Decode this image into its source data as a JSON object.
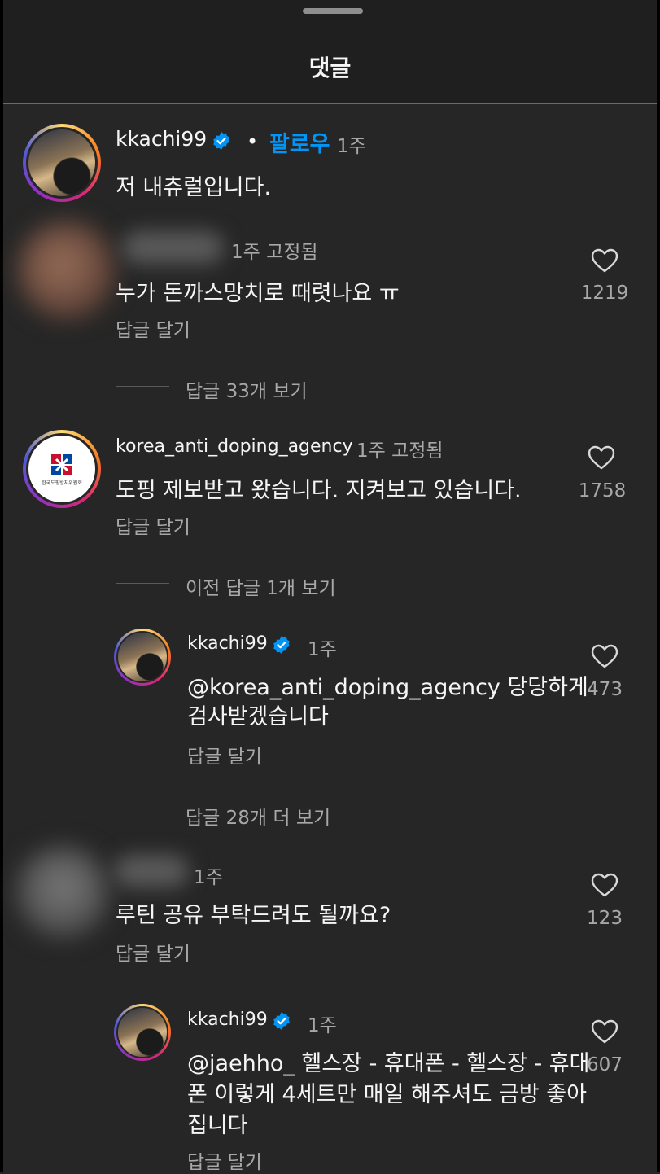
{
  "header": {
    "title": "댓글"
  },
  "comments": [
    {
      "username": "kkachi99",
      "follow_label": "팔로우",
      "time": "1주",
      "text": "저 내츄럴입니다."
    },
    {
      "meta": "1주 고정됨",
      "text": "누가 돈까스망치로 때렷나요 ㅠ",
      "reply_label": "답글 달기",
      "likes": "1219",
      "view_replies": "답글 33개 보기"
    },
    {
      "username": "korea_anti_doping_agency",
      "meta": "1주 고정됨",
      "text": "도핑 제보받고 왔습니다. 지켜보고 있습니다.",
      "reply_label": "답글 달기",
      "likes": "1758",
      "view_previous": "이전 답글 1개 보기",
      "view_more": "답글 28개 더 보기",
      "avatar_logo_text": "한국도핑방지위원회"
    },
    {
      "meta": "1주",
      "text": "루틴 공유 부탁드려도 될까요?",
      "reply_label": "답글 달기",
      "likes": "123"
    }
  ],
  "replies": [
    {
      "username": "kkachi99",
      "time": "1주",
      "text_line1": "@korea_anti_doping_agency 당당하게",
      "text_line2": "검사받겠습니다",
      "reply_label": "답글 달기",
      "likes": "473"
    },
    {
      "username": "kkachi99",
      "time": "1주",
      "text_line1": "@jaehho_ 헬스장 - 휴대폰 - 헬스장 - 휴대",
      "text_line2": "폰 이렇게 4세트만 매일 해주셔도 금방 좋아",
      "text_line3": "집니다",
      "reply_label": "답글 달기",
      "likes": "607"
    }
  ],
  "colors": {
    "background": "#262626",
    "follow": "#0095f6",
    "verified": "#0095f6"
  }
}
